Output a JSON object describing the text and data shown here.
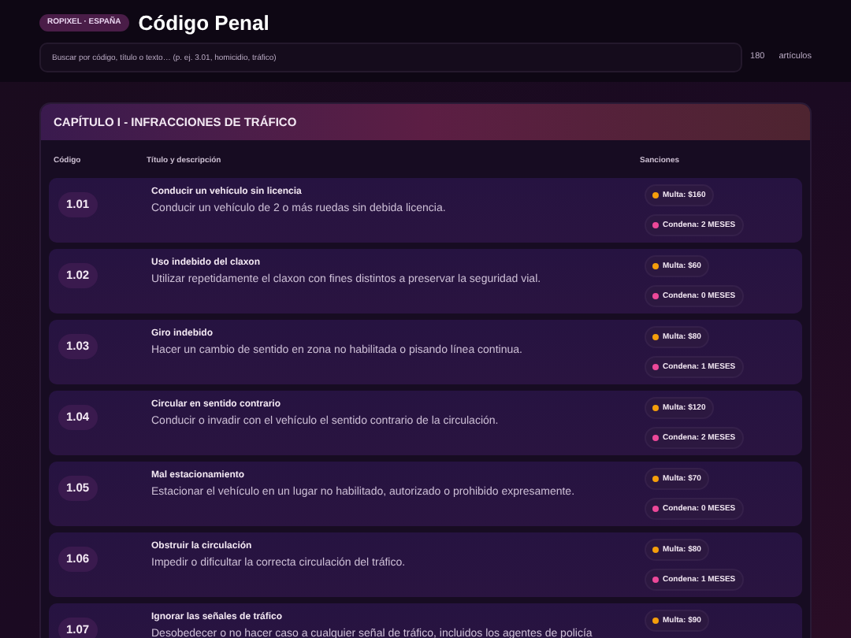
{
  "badge": "ROPIXEL · ESPAÑA",
  "title": "Código Penal",
  "search": {
    "placeholder": "Buscar por código, título o texto… (p. ej. 3.01, homicidio, tráfico)"
  },
  "count": {
    "value": "180",
    "unit": "artículos"
  },
  "chapter": {
    "title": "CAPÍTULO I - INFRACCIONES DE TRÁFICO",
    "columns": [
      "Código",
      "Título y descripción",
      "Sanciones"
    ],
    "rows": [
      {
        "code": "1.01",
        "title": "Conducir un vehículo sin licencia",
        "description": "Conducir un vehículo de 2 o más ruedas sin debida licencia.",
        "sanctions": [
          {
            "label": "Multa: $160",
            "color": "#f59e0b"
          },
          {
            "label": "Condena: 2 MESES",
            "color": "#ec4899"
          }
        ]
      },
      {
        "code": "1.02",
        "title": "Uso indebido del claxon",
        "description": "Utilizar repetidamente el claxon con fines distintos a preservar la seguridad vial.",
        "sanctions": [
          {
            "label": "Multa: $60",
            "color": "#f59e0b"
          },
          {
            "label": "Condena: 0 MESES",
            "color": "#ec4899"
          }
        ]
      },
      {
        "code": "1.03",
        "title": "Giro indebido",
        "description": "Hacer un cambio de sentido en zona no habilitada o pisando línea continua.",
        "sanctions": [
          {
            "label": "Multa: $80",
            "color": "#f59e0b"
          },
          {
            "label": "Condena: 1 MESES",
            "color": "#ec4899"
          }
        ]
      },
      {
        "code": "1.04",
        "title": "Circular en sentido contrario",
        "description": "Conducir o invadir con el vehículo el sentido contrario de la circulación.",
        "sanctions": [
          {
            "label": "Multa: $120",
            "color": "#f59e0b"
          },
          {
            "label": "Condena: 2 MESES",
            "color": "#ec4899"
          }
        ]
      },
      {
        "code": "1.05",
        "title": "Mal estacionamiento",
        "description": "Estacionar el vehículo en un lugar no habilitado, autorizado o prohibido expresamente.",
        "sanctions": [
          {
            "label": "Multa: $70",
            "color": "#f59e0b"
          },
          {
            "label": "Condena: 0 MESES",
            "color": "#ec4899"
          }
        ]
      },
      {
        "code": "1.06",
        "title": "Obstruir la circulación",
        "description": "Impedir o dificultar la correcta circulación del tráfico.",
        "sanctions": [
          {
            "label": "Multa: $80",
            "color": "#f59e0b"
          },
          {
            "label": "Condena: 1 MESES",
            "color": "#ec4899"
          }
        ]
      },
      {
        "code": "1.07",
        "title": "Ignorar las señales de tráfico",
        "description": "Desobedecer o no hacer caso a cualquier señal de tráfico, incluidos los agentes de policía",
        "sanctions": [
          {
            "label": "Multa: $90",
            "color": "#f59e0b"
          }
        ]
      }
    ]
  }
}
